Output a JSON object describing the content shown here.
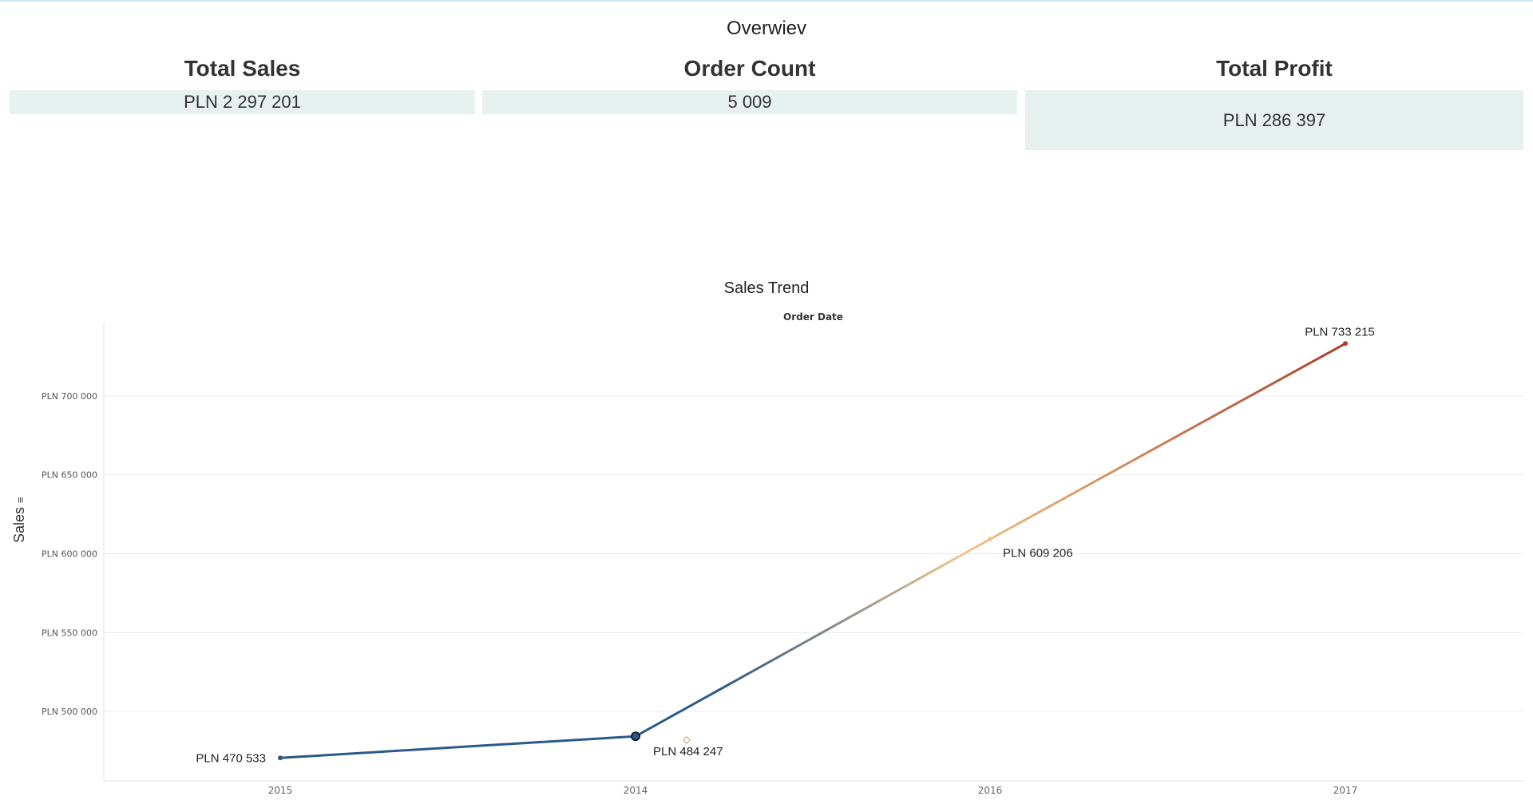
{
  "dashboard": {
    "title": "Overwiev"
  },
  "kpis": [
    {
      "label": "Total Sales",
      "value": "PLN 2 297 201"
    },
    {
      "label": "Order Count",
      "value": "5 009"
    },
    {
      "label": "Total Profit",
      "value": "PLN 286 397"
    }
  ],
  "colors": {
    "kpi_background": "#e7f1ef",
    "line_start": "#2b5a8a",
    "line_mid": "#7d8a94",
    "line_peak_light": "#f0c68c",
    "line_end": "#a8402a",
    "gridline": "#ececec"
  },
  "chart_data": {
    "type": "line",
    "title": "Sales Trend",
    "xlabel": "Order Date",
    "ylabel": "Sales",
    "categories": [
      "2015",
      "2014",
      "2016",
      "2017"
    ],
    "values": [
      470533,
      484247,
      609206,
      733215
    ],
    "data_labels": [
      "PLN 470 533",
      "PLN 484 247",
      "PLN 609 206",
      "PLN 733 215"
    ],
    "y_ticks": [
      500000,
      550000,
      600000,
      650000,
      700000
    ],
    "y_tick_labels": [
      "PLN 500 000",
      "PLN 550 000",
      "PLN 600 000",
      "PLN 650 000",
      "PLN 700 000"
    ],
    "ylim": [
      456000,
      746000
    ],
    "grid": true,
    "legend": "none",
    "color_encoding": "diverging blue-orange-red by sales value"
  }
}
